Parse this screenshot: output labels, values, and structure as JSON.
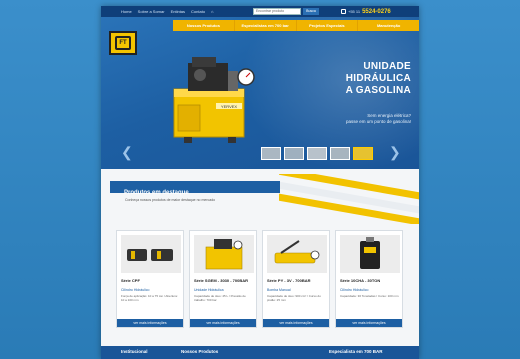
{
  "topbar": {
    "links": [
      "Home",
      "Sobre a Somar",
      "Entintas",
      "Contato"
    ],
    "search_placeholder": "Encontrar produto",
    "search_button": "Busca",
    "phone_prefix": "+55 11",
    "phone_number": "5524-0276"
  },
  "menu": {
    "items": [
      "Nossos Produtos",
      "Especialistas em 700 bar",
      "Projetos Especiais",
      "Manutenção"
    ]
  },
  "hero": {
    "headline": [
      "UNIDADE",
      "HIDRÁULICA",
      "A GASOLINA"
    ],
    "subline": [
      "Sem energia elétrica?",
      "passe em um ponto de gasolina!"
    ],
    "arrow_left": "❮",
    "arrow_right": "❯"
  },
  "products": {
    "heading": "Produtos em destaque",
    "subheading": "Conheça nossos produtos de maior destaque no mercado",
    "more_label": "ver mais informações",
    "cards": [
      {
        "title": "Série CPF",
        "category": "Cilindro Hidráulico",
        "desc": "Força de aplicação: 10 a 75 ton / Abertura: 10 a 100 mm"
      },
      {
        "title": "Série SGEM - 3030 - 700BAR",
        "category": "Unidade Hidráulica",
        "desc": "Capacidade de óleo: 45 L / Pressão de trabalho: 700 bar"
      },
      {
        "title": "Série PY - 3V - 700BAR",
        "category": "Bomba Manual",
        "desc": "Capacidade de óleo: 900 cm³ / Curso do pistão: 25 mm"
      },
      {
        "title": "Série 10CHA - 30TON",
        "category": "Cilindro Hidráulico",
        "desc": "Capacidade: 30 Toneladas / Curso: 100 mm"
      }
    ]
  },
  "footer": {
    "col1": "Institucional",
    "col2": "Nossos Produtos",
    "col3": "Especialista em 700 BAR"
  },
  "colors": {
    "brand_blue": "#1d5fa3",
    "brand_yellow": "#f0b400",
    "nav_dark": "#0f3f7a"
  }
}
